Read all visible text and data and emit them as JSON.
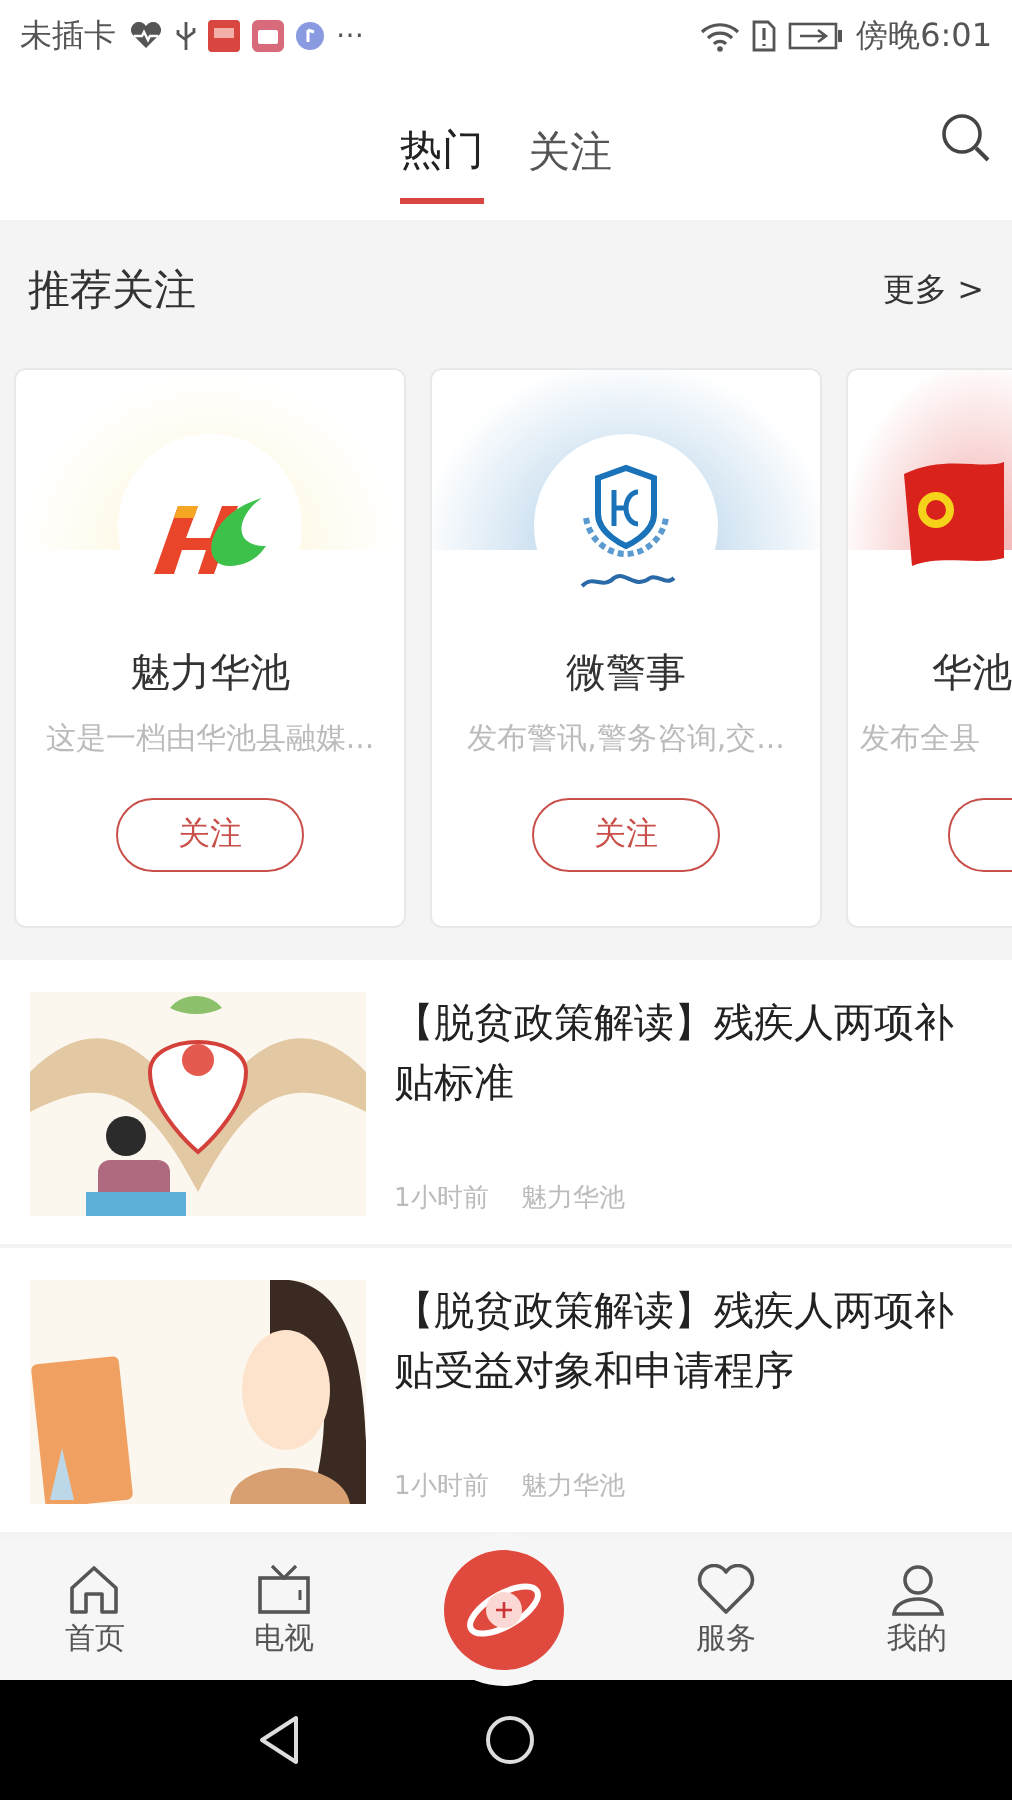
{
  "status_bar": {
    "carrier": "未插卡",
    "more": "⋯",
    "time": "傍晚6:01"
  },
  "header": {
    "tabs": [
      {
        "label": "热门",
        "selected": true
      },
      {
        "label": "关注",
        "selected": false
      }
    ]
  },
  "recommend": {
    "title": "推荐关注",
    "more": "更多 >",
    "cards": [
      {
        "kind": "hc",
        "name": "魅力华池",
        "description": "这是一档由华池县融媒...",
        "follow_label": "关注"
      },
      {
        "kind": "shield",
        "name": "微警事",
        "description": "发布警讯,警务咨询,交...",
        "follow_label": "关注"
      },
      {
        "kind": "flag",
        "name": "华池",
        "description": "发布全县"
      }
    ]
  },
  "articles": [
    {
      "title": "【脱贫政策解读】残疾人两项补贴标准",
      "time": "1小时前",
      "source": "魅力华池"
    },
    {
      "title": "【脱贫政策解读】残疾人两项补贴受益对象和申请程序",
      "time": "1小时前",
      "source": "魅力华池"
    }
  ],
  "bottom_nav": [
    {
      "kind": "home",
      "label": "首页"
    },
    {
      "kind": "tv",
      "label": "电视"
    },
    {
      "kind": "center"
    },
    {
      "kind": "heart",
      "label": "服务"
    },
    {
      "kind": "person",
      "label": "我的"
    }
  ]
}
